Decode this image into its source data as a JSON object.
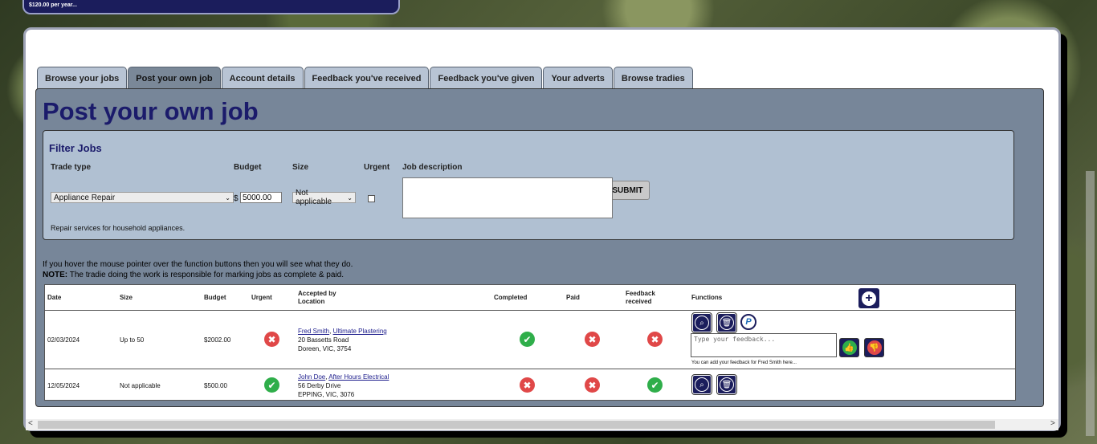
{
  "topbar": {
    "text": "$120.00 per year..."
  },
  "tabs": [
    {
      "label": "Browse your jobs",
      "active": false
    },
    {
      "label": "Post your own job",
      "active": true
    },
    {
      "label": "Account details",
      "active": false
    },
    {
      "label": "Feedback you've received",
      "active": false
    },
    {
      "label": "Feedback you've given",
      "active": false
    },
    {
      "label": "Your adverts",
      "active": false
    },
    {
      "label": "Browse tradies",
      "active": false
    }
  ],
  "page": {
    "title": "Post your own job"
  },
  "filter": {
    "title": "Filter Jobs",
    "labels": {
      "trade_type": "Trade type",
      "budget": "Budget",
      "size": "Size",
      "urgent": "Urgent",
      "job_description": "Job description"
    },
    "trade_type_value": "Appliance Repair",
    "currency_symbol": "$",
    "budget_value": "5000.00",
    "size_value": "Not applicable",
    "urgent_checked": false,
    "job_description_value": "",
    "submit_label": "SUBMIT",
    "trade_description": "Repair services for household appliances."
  },
  "hint": {
    "line1": "If you hover the mouse pointer over the function buttons then you will see what they do.",
    "note_label": "NOTE:",
    "note_text": " The tradie doing the work is responsible for marking jobs as complete & paid."
  },
  "table": {
    "headers": {
      "date": "Date",
      "size": "Size",
      "budget": "Budget",
      "urgent": "Urgent",
      "accepted_by": "Accepted by",
      "location": "Location",
      "completed": "Completed",
      "paid": "Paid",
      "feedback_1": "Feedback",
      "feedback_2": "received",
      "functions": "Functions"
    },
    "rows": [
      {
        "date": "02/03/2024",
        "size": "Up to 50",
        "budget": "$2002.00",
        "urgent": false,
        "accepted_name": "Fred Smith",
        "accepted_sep": ", ",
        "accepted_company": "Ultimate Plastering",
        "address1": "20 Bassetts Road",
        "address2": "Doreen, VIC, 3754",
        "completed": true,
        "paid": false,
        "feedback_received": false,
        "feedback_placeholder": "Type your feedback...",
        "feedback_note": "You can add your feedback for Fred Smith here..."
      },
      {
        "date": "12/05/2024",
        "size": "Not applicable",
        "budget": "$500.00",
        "urgent": true,
        "accepted_name": "John Doe",
        "accepted_sep": ", ",
        "accepted_company": "After Hours Electrical",
        "address1": "56 Derby Drive",
        "address2": "EPPING, VIC, 3076",
        "completed": false,
        "paid": false,
        "feedback_received": true
      }
    ]
  },
  "icons": {
    "view": "magnifier-icon",
    "delete": "trash-icon",
    "paypal": "paypal-icon",
    "add": "plus-icon",
    "approve": "thumbs-up-icon",
    "reject": "thumbs-down-icon",
    "check": "✔",
    "cross": "✖"
  },
  "colors": {
    "navy": "#1b1d5c",
    "red": "#e04848",
    "green": "#2fae4a",
    "panel": "#778699",
    "filter": "#b0c0d2"
  }
}
